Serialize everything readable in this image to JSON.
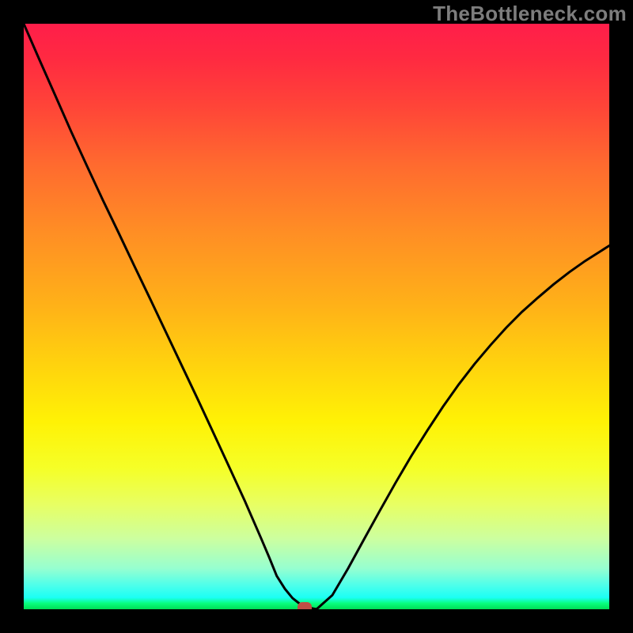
{
  "watermark": "TheBottleneck.com",
  "chart_data": {
    "type": "line",
    "title": "",
    "xlabel": "",
    "ylabel": "",
    "xlim": [
      0,
      1
    ],
    "ylim": [
      0,
      1
    ],
    "grid": false,
    "legend": false,
    "series": [
      {
        "name": "curve",
        "x": [
          0.0,
          0.027,
          0.054,
          0.081,
          0.108,
          0.135,
          0.162,
          0.189,
          0.216,
          0.243,
          0.27,
          0.297,
          0.324,
          0.351,
          0.378,
          0.405,
          0.419,
          0.432,
          0.446,
          0.459,
          0.473,
          0.486,
          0.5,
          0.527,
          0.554,
          0.581,
          0.608,
          0.635,
          0.662,
          0.689,
          0.716,
          0.743,
          0.77,
          0.797,
          0.824,
          0.851,
          0.878,
          0.905,
          0.932,
          0.959,
          0.986,
          1.0
        ],
        "y": [
          1.0,
          0.938,
          0.877,
          0.816,
          0.757,
          0.699,
          0.643,
          0.586,
          0.53,
          0.473,
          0.416,
          0.359,
          0.301,
          0.243,
          0.184,
          0.122,
          0.089,
          0.057,
          0.035,
          0.019,
          0.008,
          0.003,
          0.0,
          0.024,
          0.07,
          0.119,
          0.168,
          0.216,
          0.262,
          0.305,
          0.346,
          0.384,
          0.419,
          0.451,
          0.481,
          0.508,
          0.532,
          0.555,
          0.576,
          0.595,
          0.612,
          0.621
        ]
      }
    ],
    "marker": {
      "x": 0.48,
      "y": 0.003,
      "color": "#bf4e45"
    },
    "background_gradient": {
      "top_color": "#ff1e4a",
      "bottom_color": "#00de56"
    }
  }
}
